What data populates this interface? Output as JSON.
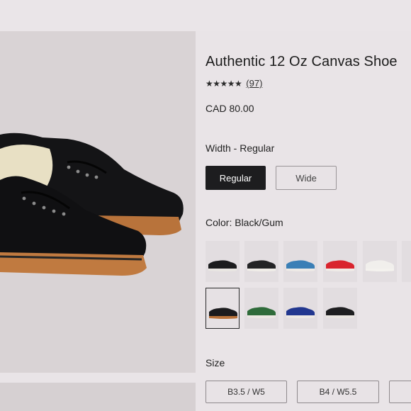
{
  "product": {
    "title": "Authentic 12 Oz Canvas Shoe",
    "rating_stars": "★★★★★",
    "review_count": "(97)",
    "price": "CAD 80.00"
  },
  "width": {
    "label": "Width - Regular",
    "options": [
      "Regular",
      "Wide"
    ],
    "selected": "Regular"
  },
  "color": {
    "label": "Color: Black/Gum",
    "swatches": [
      {
        "name": "black-white",
        "upper": "#1c1c1e",
        "sole": "#e9e6e2"
      },
      {
        "name": "black-white-sole",
        "upper": "#242426",
        "sole": "#f0ede8"
      },
      {
        "name": "blue",
        "upper": "#3b7fb6",
        "sole": "#eeeae6"
      },
      {
        "name": "red",
        "upper": "#d9242e",
        "sole": "#efebe7"
      },
      {
        "name": "white",
        "upper": "#f1efec",
        "sole": "#f4f2ee"
      },
      {
        "name": "black-gum",
        "upper": "#1b1b1d",
        "sole": "#b9733a",
        "selected": true
      },
      {
        "name": "green",
        "upper": "#2f6b3a",
        "sole": "#ece8e2"
      },
      {
        "name": "navy",
        "upper": "#22378f",
        "sole": "#ede9e4"
      },
      {
        "name": "black-red",
        "upper": "#1e1e20",
        "sole": "#e9e5e0"
      }
    ]
  },
  "size": {
    "label": "Size",
    "options": [
      "B3.5 / W5",
      "B4 / W5.5"
    ]
  },
  "colors": {
    "primary_button": "#1d1d1f",
    "gum_sole": "#b9733a"
  }
}
